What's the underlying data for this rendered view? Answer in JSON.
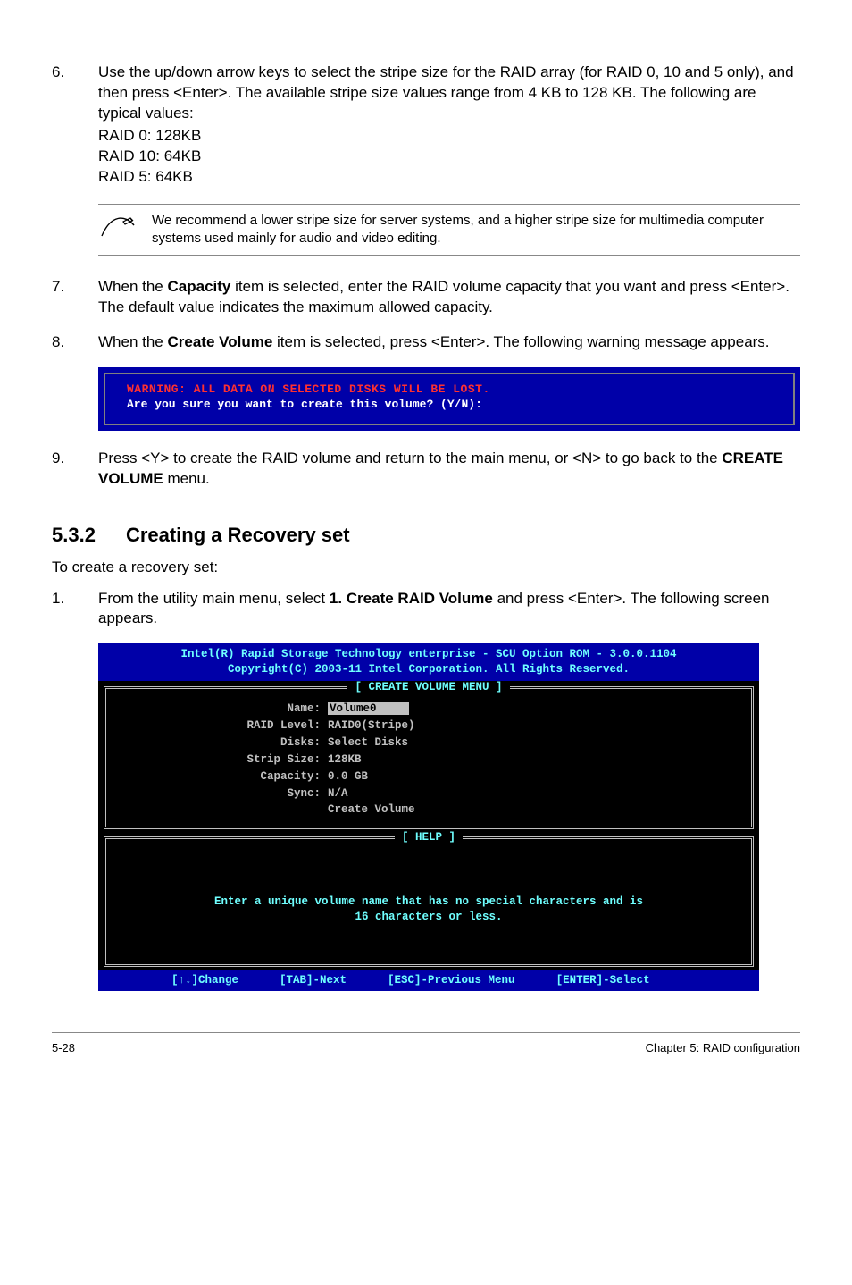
{
  "step6": {
    "num": "6.",
    "text": "Use the up/down arrow keys to select the stripe size for the RAID array (for RAID 0, 10 and 5 only), and then press <Enter>. The available stripe size values range from 4 KB to 128 KB. The following are typical values:",
    "l1": "RAID 0: 128KB",
    "l2": "RAID 10: 64KB",
    "l3": "RAID 5: 64KB"
  },
  "note": "We recommend a lower stripe size for server systems, and a higher stripe size for multimedia computer systems used mainly for audio and video editing.",
  "step7": {
    "num": "7.",
    "pre": "When the ",
    "bold": "Capacity",
    "post": " item is selected, enter the RAID volume capacity that you want and press <Enter>. The default value indicates the maximum allowed capacity."
  },
  "step8": {
    "num": "8.",
    "pre": "When the ",
    "bold": "Create Volume",
    "post": " item is selected, press <Enter>. The following warning message appears."
  },
  "warn": {
    "red": "WARNING: ALL DATA ON SELECTED DISKS WILL BE LOST.",
    "white": "Are you sure you want to create this volume? (Y/N):"
  },
  "step9": {
    "num": "9.",
    "pre": "Press <Y> to create the RAID volume and return to the main menu, or <N> to go back to the ",
    "bold": "CREATE VOLUME",
    "post": " menu."
  },
  "section": {
    "num": "5.3.2",
    "title": "Creating a Recovery set"
  },
  "intro": "To create a recovery set:",
  "step1": {
    "num": "1.",
    "pre": "From the utility main menu, select ",
    "bold": "1. Create RAID Volume",
    "post": " and press <Enter>. The following screen appears."
  },
  "bios": {
    "header1": "Intel(R) Rapid Storage Technology enterprise - SCU Option ROM - 3.0.0.1104",
    "header2": "Copyright(C) 2003-11 Intel Corporation.  All Rights Reserved.",
    "panel1_title": "[ CREATE VOLUME MENU ]",
    "panel2_title": "[ HELP ]",
    "fields": {
      "name_label": "Name:",
      "name_value": "Volume0",
      "raid_label": "RAID Level:",
      "raid_value": "RAID0(Stripe)",
      "disks_label": "Disks:",
      "disks_value": "Select Disks",
      "strip_label": "Strip Size:",
      "strip_value": " 128KB",
      "cap_label": "Capacity:",
      "cap_value": "0.0   GB",
      "sync_label": "Sync:",
      "sync_value": "N/A",
      "create_value": "Create Volume"
    },
    "help_line1": "Enter a unique volume name that has no special characters and is",
    "help_line2": "16 characters or less.",
    "footer": {
      "k1": "[↑↓]Change",
      "k2": "[TAB]-Next",
      "k3": "[ESC]-Previous Menu",
      "k4": "[ENTER]-Select"
    }
  },
  "page_footer": {
    "left": "5-28",
    "right": "Chapter 5: RAID configuration"
  }
}
